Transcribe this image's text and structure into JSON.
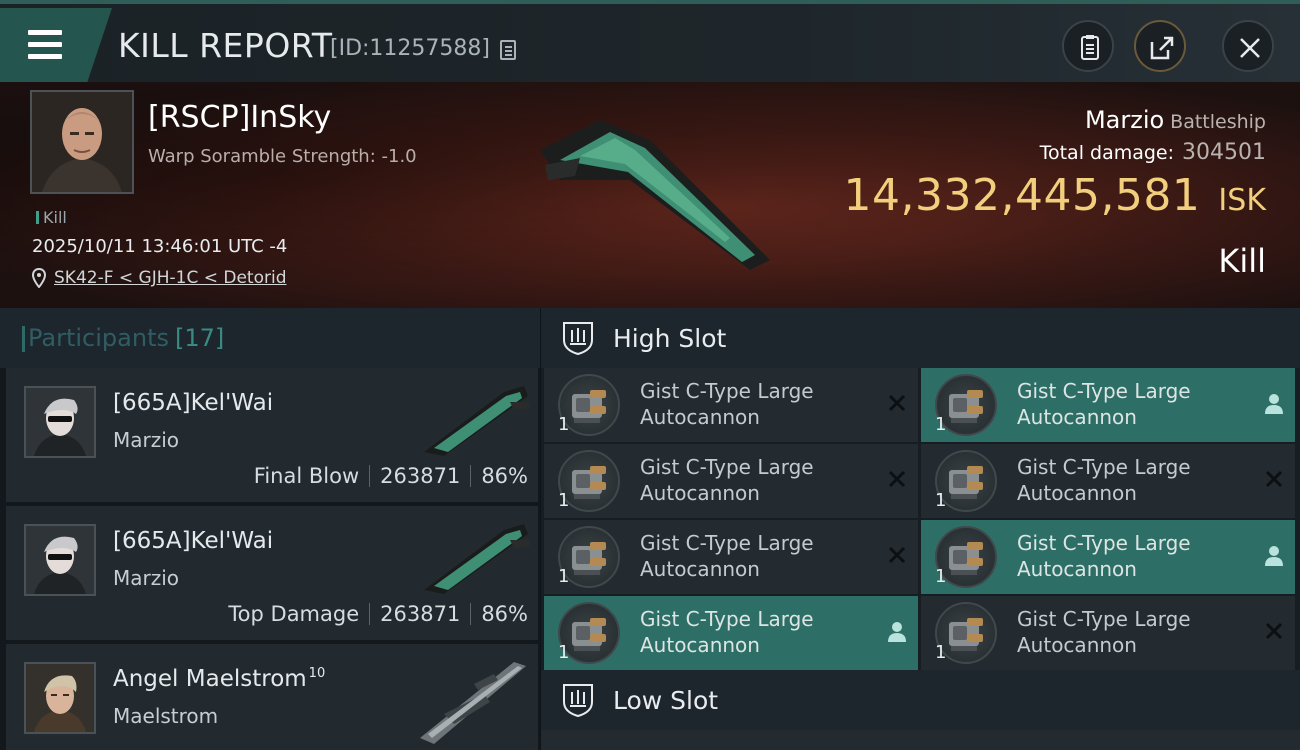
{
  "header": {
    "title": "KILL REPORT",
    "report_id": "[ID:11257588]"
  },
  "victim": {
    "name": "[RSCP]InSky",
    "detail": "Warp Soramble Strength: -1.0",
    "tag": "Kill",
    "datetime": "2025/10/11 13:46:01 UTC -4",
    "location": "SK42-F < GJH-1C < Detorid",
    "ship_name": "Marzio",
    "ship_class": "Battleship",
    "total_damage_label": "Total damage:",
    "total_damage": "304501",
    "isk_value": "14,332,445,581",
    "isk_unit": "ISK",
    "result": "Kill"
  },
  "participants": {
    "label": "Participants",
    "count": "[17]",
    "rows": [
      {
        "name": "[665A]Kel'Wai",
        "ship": "Marzio",
        "role": "Final Blow",
        "damage": "263871",
        "percent": "86%"
      },
      {
        "name": "[665A]Kel'Wai",
        "ship": "Marzio",
        "role": "Top Damage",
        "damage": "263871",
        "percent": "86%"
      },
      {
        "name": "Angel Maelstrom",
        "level": "10",
        "ship": "Maelstrom"
      }
    ]
  },
  "slots": {
    "high_label": "High Slot",
    "low_label": "Low Slot",
    "modules": [
      {
        "line1": "Gist C-Type Large",
        "line2": "Autocannon",
        "qty": "1",
        "status": "destroyed-icon"
      },
      {
        "line1": "Gist C-Type Large",
        "line2": "Autocannon",
        "qty": "1",
        "status": "dropped-icon"
      },
      {
        "line1": "Gist C-Type Large",
        "line2": "Autocannon",
        "qty": "1",
        "status": "destroyed-icon"
      },
      {
        "line1": "Gist C-Type Large",
        "line2": "Autocannon",
        "qty": "1",
        "status": "destroyed-icon"
      },
      {
        "line1": "Gist C-Type Large",
        "line2": "Autocannon",
        "qty": "1",
        "status": "destroyed-icon"
      },
      {
        "line1": "Gist C-Type Large",
        "line2": "Autocannon",
        "qty": "1",
        "status": "dropped-icon"
      },
      {
        "line1": "Gist C-Type Large",
        "line2": "Autocannon",
        "qty": "1",
        "status": "dropped-icon"
      },
      {
        "line1": "Gist C-Type Large",
        "line2": "Autocannon",
        "qty": "1",
        "status": "destroyed-icon"
      }
    ]
  },
  "colors": {
    "accent": "#2d6f66",
    "isk": "#f2cf7c",
    "panel": "#232b31"
  }
}
